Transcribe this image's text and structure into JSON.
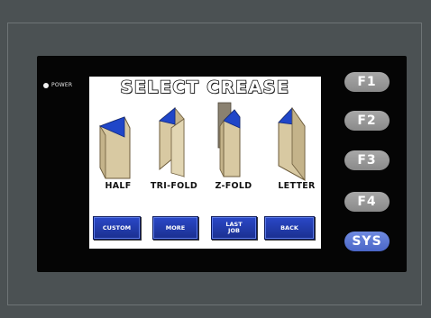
{
  "device": {
    "power_label": "POWER",
    "function_keys": [
      "F1",
      "F2",
      "F3",
      "F4",
      "SYS"
    ]
  },
  "screen": {
    "title": "SELECT CREASE",
    "folds": [
      {
        "label": "HALF",
        "icon": "half-fold-icon"
      },
      {
        "label": "TRI-FOLD",
        "icon": "tri-fold-icon"
      },
      {
        "label": "Z-FOLD",
        "icon": "z-fold-icon"
      },
      {
        "label": "LETTER",
        "icon": "letter-fold-icon"
      }
    ],
    "buttons": [
      "CUSTOM",
      "MORE",
      "LAST\nJOB",
      "BACK"
    ]
  },
  "colors": {
    "bezel": "#4b5153",
    "button_blue": "#1f3bb0",
    "fold_tan": "#d8c9a2",
    "fold_blue": "#2046c8",
    "sys_key": "#5b77d6"
  }
}
